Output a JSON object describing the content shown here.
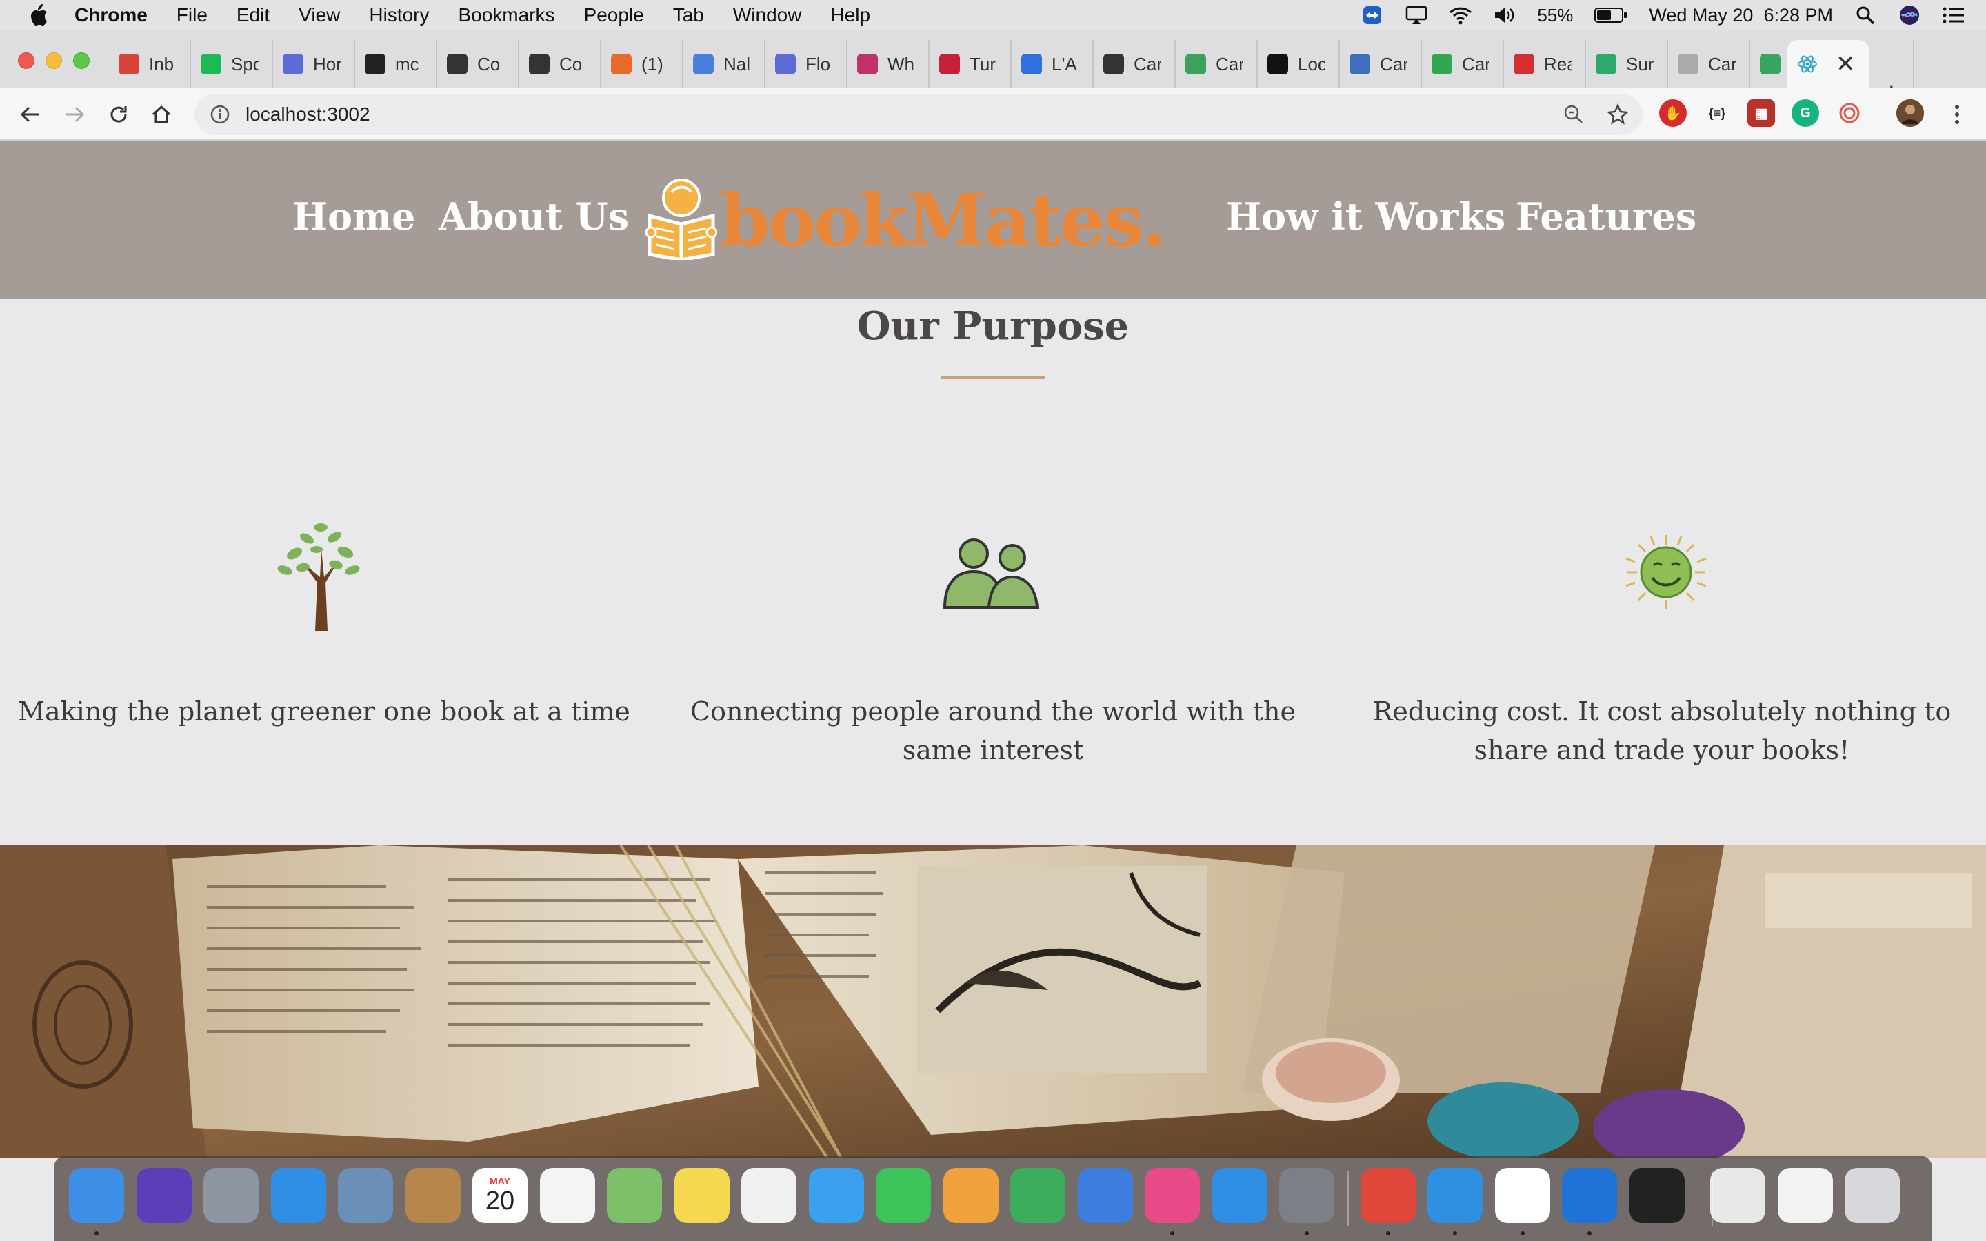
{
  "menubar": {
    "app_name": "Chrome",
    "items": [
      "File",
      "Edit",
      "View",
      "History",
      "Bookmarks",
      "People",
      "Tab",
      "Window",
      "Help"
    ],
    "battery": "55%",
    "clock": "Wed May 20  6:28 PM"
  },
  "tabs": [
    {
      "title": "Inb",
      "icon": "gmail-icon",
      "color": "#d8443a"
    },
    {
      "title": "Spc",
      "icon": "spotify-icon",
      "color": "#1db954"
    },
    {
      "title": "Hor",
      "icon": "c-logo-icon",
      "color": "#5b6bd6"
    },
    {
      "title": "mc",
      "icon": "github-icon",
      "color": "#222222"
    },
    {
      "title": "Co",
      "icon": "plus-circle-icon",
      "color": "#333333"
    },
    {
      "title": "Co",
      "icon": "plus-circle-icon",
      "color": "#333333"
    },
    {
      "title": "(1)",
      "icon": "codepen-icon",
      "color": "#e96b2b"
    },
    {
      "title": "Nal",
      "icon": "docs-icon",
      "color": "#4a7fe0"
    },
    {
      "title": "Flo",
      "icon": "c-logo-icon",
      "color": "#5b6bd6"
    },
    {
      "title": "Wh",
      "icon": "slash-icon",
      "color": "#c0306b"
    },
    {
      "title": "Tur",
      "icon": "magnet-icon",
      "color": "#c8203a"
    },
    {
      "title": "L'A",
      "icon": "diamond-icon",
      "color": "#2f6fe0"
    },
    {
      "title": "Car",
      "icon": "check-circle-icon",
      "color": "#333333"
    },
    {
      "title": "Car",
      "icon": "kanban-icon",
      "color": "#3aa35b"
    },
    {
      "title": "Loc",
      "icon": "loop-icon",
      "color": "#111111"
    },
    {
      "title": "Car",
      "icon": "fish-icon",
      "color": "#3b6fc0"
    },
    {
      "title": "Car",
      "icon": "p-logo-icon",
      "color": "#2fa84f"
    },
    {
      "title": "Rea",
      "icon": "house-icon",
      "color": "#d62d2d"
    },
    {
      "title": "Sur",
      "icon": "cloud-icon",
      "color": "#2fa86b"
    },
    {
      "title": "Car",
      "icon": "blank-page-icon",
      "color": "#aaaaaa"
    },
    {
      "title": "",
      "icon": "chat-bubble-icon",
      "color": "#36a65e"
    },
    {
      "title": "",
      "icon": "record-icon",
      "color": "#e03030"
    }
  ],
  "active_tab": {
    "icon": "react-icon",
    "color": "#2aa4c9"
  },
  "omnibox": {
    "url": "localhost:3002"
  },
  "site": {
    "nav": {
      "home": "Home",
      "about": "About Us",
      "how": "How it Works",
      "features": "Features"
    },
    "brand": "bookMates.",
    "purpose": {
      "title": "Our Purpose",
      "features": [
        {
          "icon": "tree-icon",
          "text": "Making the planet greener one book at a time"
        },
        {
          "icon": "people-icon",
          "text": "Connecting people around the world with the same interest"
        },
        {
          "icon": "smiling-sun-icon",
          "text": "Reducing cost. It cost absolutely nothing to share and trade your books!"
        }
      ]
    }
  },
  "dock": {
    "apps": [
      {
        "name": "finder-icon",
        "color": "#3d8fe8"
      },
      {
        "name": "siri-icon",
        "color": "#5b3fb8"
      },
      {
        "name": "launchpad-icon",
        "color": "#8e96a3"
      },
      {
        "name": "safari-icon",
        "color": "#2f8fe6"
      },
      {
        "name": "mail-stamp-icon",
        "color": "#6a8fb8"
      },
      {
        "name": "contacts-icon",
        "color": "#b7864a"
      },
      {
        "name": "calendar-icon",
        "color": "#ffffff",
        "label": "20",
        "month": "MAY"
      },
      {
        "name": "reminders-icon",
        "color": "#f4f4f4"
      },
      {
        "name": "maps-icon",
        "color": "#7cc06a"
      },
      {
        "name": "notes-icon",
        "color": "#f5d84f"
      },
      {
        "name": "photos-icon",
        "color": "#f0f0f0"
      },
      {
        "name": "messages-icon",
        "color": "#3aa0f0"
      },
      {
        "name": "facetime-icon",
        "color": "#3cc45a"
      },
      {
        "name": "pages-icon",
        "color": "#f0a23c"
      },
      {
        "name": "numbers-icon",
        "color": "#3cae5b"
      },
      {
        "name": "keynote-icon",
        "color": "#3d7de0"
      },
      {
        "name": "itunes-icon",
        "color": "#e94a8a"
      },
      {
        "name": "app-store-icon",
        "color": "#2f8fe6"
      },
      {
        "name": "system-preferences-icon",
        "color": "#7a7f88"
      },
      {
        "name": "chrome-icon",
        "color": "#e0463a"
      },
      {
        "name": "vscode-icon",
        "color": "#2f8fe0"
      },
      {
        "name": "slack-icon",
        "color": "#ffffff"
      },
      {
        "name": "teamviewer-icon",
        "color": "#1f72d6"
      },
      {
        "name": "terminal-icon",
        "color": "#222222"
      },
      {
        "name": "avatar-folder-icon",
        "color": "#e8e8e8"
      },
      {
        "name": "window-thumbnail-icon",
        "color": "#f2f2f2"
      },
      {
        "name": "trash-icon",
        "color": "#d8d8dc"
      }
    ]
  }
}
